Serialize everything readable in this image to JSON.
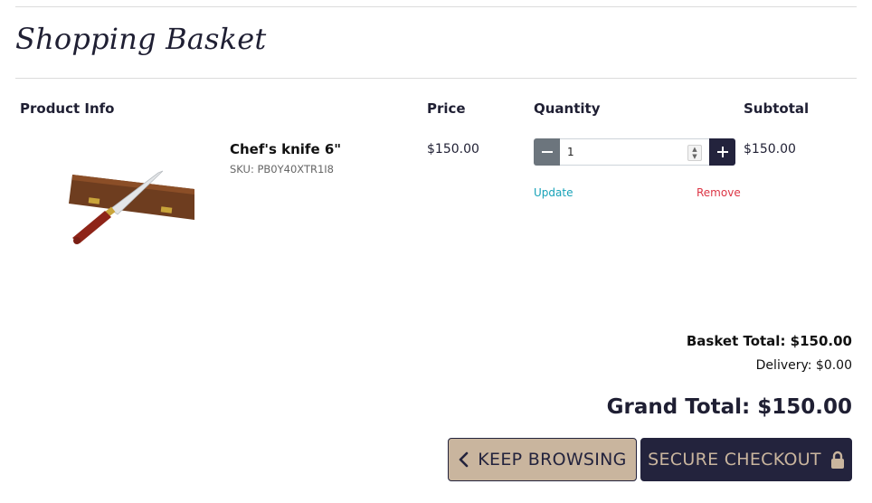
{
  "page": {
    "title": "Shopping Basket"
  },
  "table": {
    "headers": {
      "product_info": "Product Info",
      "price": "Price",
      "quantity": "Quantity",
      "subtotal": "Subtotal"
    }
  },
  "item": {
    "name": "Chef's knife 6\"",
    "sku": "SKU: PB0Y40XTR1I8",
    "price": "$150.00",
    "quantity_value": "1",
    "subtotal": "$150.00",
    "update_label": "Update",
    "remove_label": "Remove",
    "image_icon": "knife-in-wooden-box"
  },
  "totals": {
    "basket_total": "Basket Total: $150.00",
    "delivery": "Delivery: $0.00",
    "grand_total": "Grand Total: $150.00"
  },
  "actions": {
    "keep_browsing_label": "KEEP BROWSING",
    "secure_checkout_label": "SECURE CHECKOUT",
    "keep_browsing_icon": "chevron-left-icon",
    "secure_checkout_icon": "lock-icon"
  },
  "colors": {
    "primary_dark": "#23233d",
    "accent_tan": "#c9b59e",
    "update_link": "#17a2b8",
    "remove_link": "#dc3545",
    "minus_button": "#6c757d"
  }
}
